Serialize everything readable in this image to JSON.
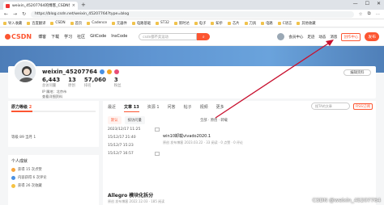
{
  "browser": {
    "tab_title": "weixin_45207764的博客_CSDN博客",
    "tab_close": "×",
    "new_tab": "+",
    "url": "https://blog.csdn.net/weixin_45207764?type=blog",
    "window_controls": [
      "—",
      "☐",
      "✕"
    ]
  },
  "bookmarks": [
    "导入收藏",
    "百度翻译",
    "CSDN",
    "首页",
    "Cadence",
    "元器件",
    "电路基础",
    "",
    "ST32",
    "新时达",
    "电子",
    "知乎",
    "芯片",
    "刀具",
    "电路",
    "C语言",
    "其他收藏"
  ],
  "csdn_header": {
    "logo": "CSDN",
    "nav": [
      "博客",
      "下载",
      "学习",
      "社区",
      "GitCode",
      "InsCode"
    ],
    "search_placeholder": "csdn都不卖运动",
    "search_button": "搜索",
    "right_nav": [
      "会员中心",
      "足迹",
      "动态",
      "消息",
      "创作中心"
    ],
    "publish": "发布"
  },
  "profile": {
    "username": "weixin_45207764",
    "stats": [
      {
        "value": "6,443",
        "label": "总访问量"
      },
      {
        "value": "13",
        "label": "原创"
      },
      {
        "value": "57,060",
        "label": "排名"
      },
      {
        "value": "3",
        "label": "粉丝"
      }
    ],
    "ip": "IP 属地：北京市",
    "more": "查看详细资料",
    "edit_button": "编辑资料"
  },
  "level": {
    "title": "原力等级",
    "value": "2",
    "progress": 0.25,
    "rows": "等级 89    当月 1"
  },
  "achievements": {
    "title": "个人成就",
    "items": [
      "获得 15 次点赞",
      "内容获得 6 次评论",
      "获得 26 次收藏"
    ]
  },
  "content": {
    "tabs": [
      "最近",
      "文章",
      "资源",
      "问答",
      "帖子",
      "视频",
      "更多"
    ],
    "tab_counts": {
      "文章": "13",
      "资源": "1"
    },
    "search_placeholder": "搜TA的文章",
    "rss": "RSS订阅",
    "filters": [
      "默认",
      "按访问量"
    ],
    "filter_right": "全部 · 原创 · 转载",
    "entries": [
      {
        "date": "2023/12/17 11:25",
        "title": ""
      },
      {
        "date": "15/12/17 21:40",
        "title": "win10卸载vivado2020.1"
      },
      {
        "date": "15/12/7 15:23",
        "title": ""
      },
      {
        "date": "15/12/7 16:57",
        "title": ""
      }
    ],
    "article_meta": "原创 发布博客 2023.03.22 · 33 阅读 · 0 点赞 · 0 评论",
    "article2_title": "Allegro 模块化拆分",
    "article2_meta": "原创 发布博客 2022.12.03 · 185 阅读"
  },
  "watermark": "CSDN @weixin_45207764",
  "colors": {
    "accent": "#fc5531",
    "banner": "#5f95d2",
    "annotation_arrow": "#c8102e"
  }
}
